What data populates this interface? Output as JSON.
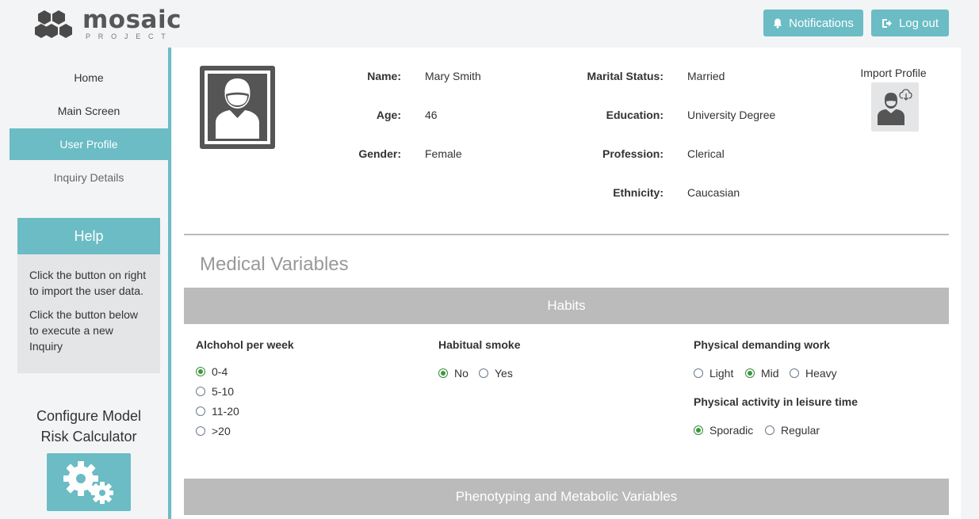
{
  "header": {
    "logo_name": "mosaic",
    "logo_sub": "PROJECT",
    "notifications_label": "Notifications",
    "logout_label": "Log out",
    "accent_color": "#6bbcc4"
  },
  "sidebar": {
    "items": [
      {
        "label": "Home"
      },
      {
        "label": "Main Screen"
      },
      {
        "label": "User Profile"
      },
      {
        "label": "Inquiry Details"
      }
    ],
    "help": {
      "title": "Help",
      "line1": "Click the button on right to import the user data.",
      "line2": "Click the button below to execute a new Inquiry"
    },
    "config": {
      "line1": "Configure Model",
      "line2": "Risk Calculator",
      "icon": "gears-icon"
    }
  },
  "profile": {
    "name_label": "Name:",
    "name": "Mary Smith",
    "age_label": "Age:",
    "age": "46",
    "gender_label": "Gender:",
    "gender": "Female",
    "marital_label": "Marital Status:",
    "marital": "Married",
    "education_label": "Education:",
    "education": "University Degree",
    "profession_label": "Profession:",
    "profession": "Clerical",
    "ethnicity_label": "Ethnicity:",
    "ethnicity": "Caucasian",
    "import_label": "Import Profile"
  },
  "medical": {
    "title": "Medical Variables",
    "habits": {
      "header": "Habits",
      "alcohol": {
        "title": "Alchohol per week",
        "options": [
          "0-4",
          "5-10",
          "11-20",
          ">20"
        ],
        "selected": "0-4"
      },
      "smoke": {
        "title": "Habitual smoke",
        "options": [
          "No",
          "Yes"
        ],
        "selected": "No"
      },
      "work": {
        "title": "Physical demanding work",
        "options": [
          "Light",
          "Mid",
          "Heavy"
        ],
        "selected": "Mid"
      },
      "leisure": {
        "title": "Physical activity in leisure time",
        "options": [
          "Sporadic",
          "Regular"
        ],
        "selected": "Sporadic"
      }
    },
    "phenotyping_header": "Phenotyping and Metabolic Variables"
  }
}
